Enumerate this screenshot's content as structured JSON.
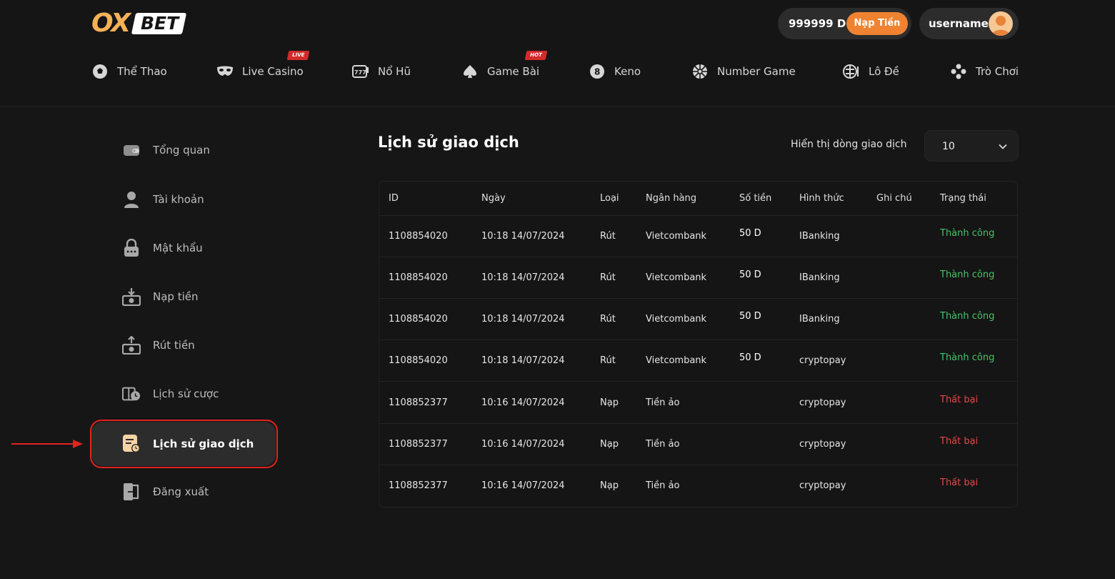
{
  "brand": {
    "logo_left": "OX",
    "logo_right": "BET",
    "accent": "#ef8331",
    "logo_color": "#f4b157"
  },
  "header": {
    "balance": "999999 D",
    "deposit_label": "Nạp Tiền",
    "username": "username"
  },
  "nav": [
    {
      "label": "Thể Thao",
      "icon": "soccer-ball-icon"
    },
    {
      "label": "Live Casino",
      "icon": "mask-icon",
      "badge": "LIVE"
    },
    {
      "label": "Nổ Hũ",
      "icon": "slot-777-icon"
    },
    {
      "label": "Game Bài",
      "icon": "spade-icon",
      "badge": "HOT"
    },
    {
      "label": "Keno",
      "icon": "ball-8-icon"
    },
    {
      "label": "Number Game",
      "icon": "wheel-icon"
    },
    {
      "label": "Lô Đề",
      "icon": "lottery-icon"
    },
    {
      "label": "Trò Chơi",
      "icon": "gamepad-icon"
    }
  ],
  "sidebar": [
    {
      "label": "Tổng quan",
      "icon": "wallet-icon"
    },
    {
      "label": "Tài khoản",
      "icon": "user-icon"
    },
    {
      "label": "Mật khẩu",
      "icon": "lock-icon"
    },
    {
      "label": "Nạp tiền",
      "icon": "deposit-icon"
    },
    {
      "label": "Rút tiền",
      "icon": "withdraw-icon"
    },
    {
      "label": "Lịch sử cược",
      "icon": "bet-history-icon"
    },
    {
      "label": "Lịch sử giao dịch",
      "icon": "transaction-history-icon",
      "active": true
    },
    {
      "label": "Đăng xuất",
      "icon": "logout-icon"
    }
  ],
  "main": {
    "title": "Lịch sử giao dịch",
    "rows_label": "Hiển thị dòng giao dịch",
    "rows_value": "10",
    "columns": [
      "ID",
      "Ngày",
      "Loại",
      "Ngân hàng",
      "Số tiền",
      "Hình thức",
      "Ghi chú",
      "Trạng thái"
    ],
    "rows": [
      {
        "id": "1108854020",
        "date": "10:18 14/07/2024",
        "type": "Rút",
        "bank": "Vietcombank",
        "amount": "50 D",
        "method": "IBanking",
        "note": "",
        "status": "Thành công",
        "ok": true
      },
      {
        "id": "1108854020",
        "date": "10:18 14/07/2024",
        "type": "Rút",
        "bank": "Vietcombank",
        "amount": "50 D",
        "method": "IBanking",
        "note": "",
        "status": "Thành công",
        "ok": true
      },
      {
        "id": "1108854020",
        "date": "10:18 14/07/2024",
        "type": "Rút",
        "bank": "Vietcombank",
        "amount": "50 D",
        "method": "IBanking",
        "note": "",
        "status": "Thành công",
        "ok": true
      },
      {
        "id": "1108854020",
        "date": "10:18 14/07/2024",
        "type": "Rút",
        "bank": "Vietcombank",
        "amount": "50 D",
        "method": "cryptopay",
        "note": "",
        "status": "Thành công",
        "ok": true
      },
      {
        "id": "1108852377",
        "date": "10:16 14/07/2024",
        "type": "Nạp",
        "bank": "Tiền ảo",
        "amount": "",
        "method": "cryptopay",
        "note": "",
        "status": "Thất bại",
        "ok": false
      },
      {
        "id": "1108852377",
        "date": "10:16 14/07/2024",
        "type": "Nạp",
        "bank": "Tiền ảo",
        "amount": "",
        "method": "cryptopay",
        "note": "",
        "status": "Thất bại",
        "ok": false
      },
      {
        "id": "1108852377",
        "date": "10:16 14/07/2024",
        "type": "Nạp",
        "bank": "Tiền ảo",
        "amount": "",
        "method": "cryptopay",
        "note": "",
        "status": "Thất bại",
        "ok": false
      }
    ],
    "status_colors": {
      "success": "#46c46b",
      "failure": "#e34848"
    }
  }
}
